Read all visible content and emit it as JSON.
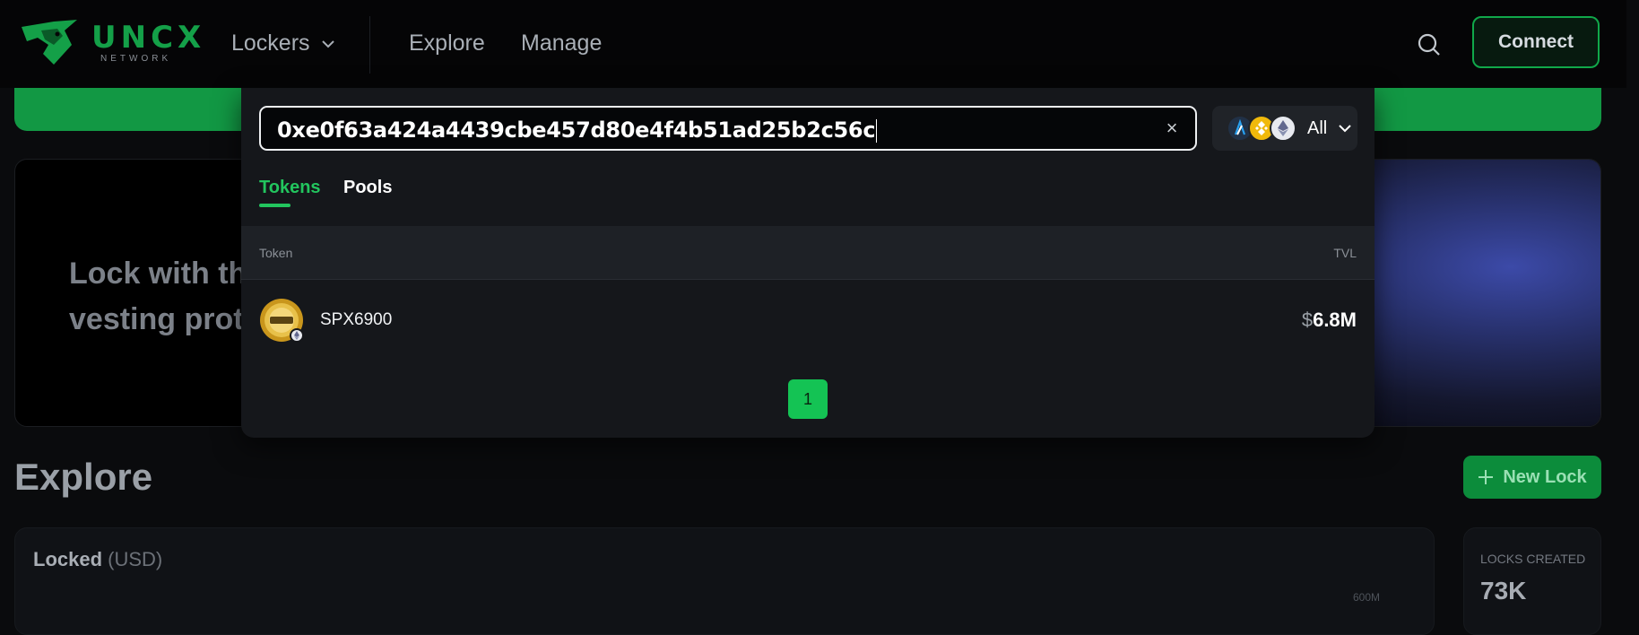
{
  "nav": {
    "logo_text": "UNCX",
    "logo_sub": "NETWORK",
    "lockers_label": "Lockers",
    "explore_label": "Explore",
    "manage_label": "Manage",
    "connect_label": "Connect"
  },
  "hero": {
    "line1": "Lock with th",
    "line2": "vesting prot"
  },
  "explore": {
    "title": "Explore",
    "new_lock_label": "New Lock",
    "locked_title": "Locked",
    "locked_unit": "(USD)",
    "axis_label": "600M",
    "locks_created_label": "LOCKS CREATED",
    "locks_created_value": "73K"
  },
  "search": {
    "query": "0xe0f63a424a4439cbe457d80e4f4b51ad25b2c56c",
    "clear_symbol": "×",
    "chain_label": "All",
    "tabs": [
      {
        "label": "Tokens",
        "active": true
      },
      {
        "label": "Pools",
        "active": false
      }
    ],
    "columns": {
      "token": "Token",
      "tvl": "TVL"
    },
    "results": [
      {
        "name": "SPX6900",
        "tvl_currency": "$",
        "tvl_value": "6.8M",
        "chain_icon": "ethereum-icon"
      }
    ],
    "pagination": {
      "current": "1"
    }
  },
  "colors": {
    "accent": "#22c55e",
    "brand_green": "#129844",
    "panel_bg": "#15171b",
    "page_bg": "#0a0b0d"
  }
}
